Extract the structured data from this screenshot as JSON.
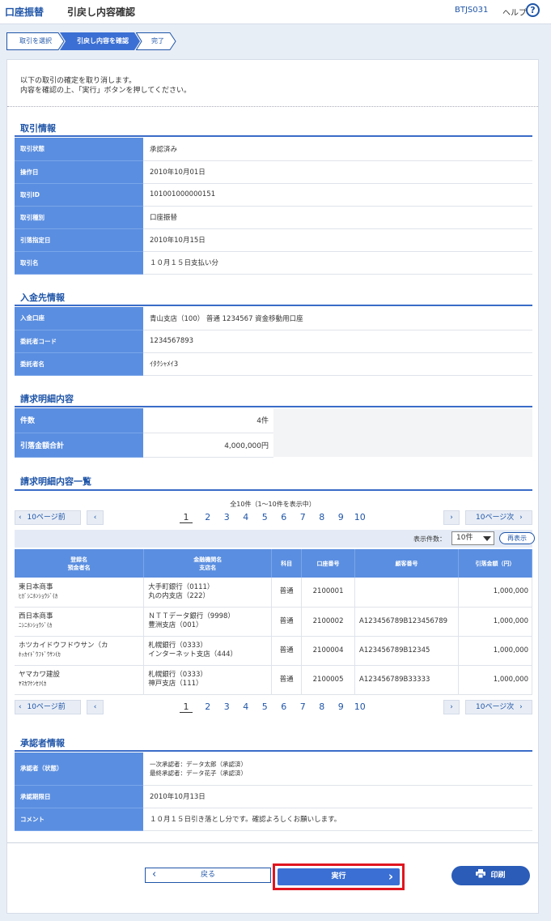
{
  "header": {
    "breadcrumb": "口座振替",
    "title": "引戻し内容確認",
    "screen_code": "BTJS031",
    "help_label": "ヘルプ",
    "help_icon": "?"
  },
  "steps": [
    "取引を選択",
    "引戻し内容を確認",
    "完了"
  ],
  "intro": [
    "以下の取引の確定を取り消します。",
    "内容を確認の上、「実行」ボタンを押してください。"
  ],
  "transaction_info": {
    "title": "取引情報",
    "rows": [
      {
        "label": "取引状態",
        "value": "承認済み"
      },
      {
        "label": "操作日",
        "value": "2010年10月01日"
      },
      {
        "label": "取引ID",
        "value": "101001000000151"
      },
      {
        "label": "取引種別",
        "value": "口座振替"
      },
      {
        "label": "引落指定日",
        "value": "2010年10月15日"
      },
      {
        "label": "取引名",
        "value": "１０月１５日支払い分"
      }
    ]
  },
  "deposit_info": {
    "title": "入金先情報",
    "rows": [
      {
        "label": "入金口座",
        "value": "青山支店（100） 普通 1234567 資金移動用口座"
      },
      {
        "label": "委託者コード",
        "value": "1234567893"
      },
      {
        "label": "委託者名",
        "value": "ｲﾀｸｼｬﾒｲ3"
      }
    ]
  },
  "billing_summary": {
    "title": "請求明細内容",
    "rows": [
      {
        "label": "件数",
        "value": "4件"
      },
      {
        "label": "引落金額合計",
        "value": "4,000,000円"
      }
    ]
  },
  "billing_list": {
    "title": "請求明細内容一覧",
    "count_text": "全10件（1～10件を表示中）",
    "prev10": "10ページ前",
    "next10": "10ページ次",
    "pages": [
      "1",
      "2",
      "3",
      "4",
      "5",
      "6",
      "7",
      "8",
      "9",
      "10"
    ],
    "display_count_label": "表示件数：",
    "display_count_value": "10件",
    "redisplay_label": "再表示",
    "headers": {
      "registrant": "登録名",
      "depositor": "預金者名",
      "bank": "金融機関名",
      "branch": "支店名",
      "subject": "科目",
      "account_no": "口座番号",
      "customer_no": "顧客番号",
      "amount": "引落金額（円）"
    },
    "rows": [
      {
        "registrant": "東日本商事",
        "depositor": "ﾋｶﾞｼﾆﾎﾝｼｮｳｼﾞ(ｶ",
        "bank": "大手町銀行（0111）",
        "branch": "丸の内支店（222）",
        "subject": "普通",
        "account_no": "2100001",
        "customer_no": "",
        "amount": "1,000,000"
      },
      {
        "registrant": "西日本商事",
        "depositor": "ﾆｼﾆﾎﾝｼｮｳｼﾞ(ｶ",
        "bank": "ＮＴＴデータ銀行（9998）",
        "branch": "豊洲支店（001）",
        "subject": "普通",
        "account_no": "2100002",
        "customer_no": "A123456789B123456789",
        "amount": "1,000,000"
      },
      {
        "registrant": "ホツカイドウフドウサン（カ",
        "depositor": "ﾎｯｶｲﾄﾞｳﾌﾄﾞｳｻﾝ(ｶ",
        "bank": "札幌銀行（0333）",
        "branch": "インターネット支店（444）",
        "subject": "普通",
        "account_no": "2100004",
        "customer_no": "A123456789B12345",
        "amount": "1,000,000"
      },
      {
        "registrant": "ヤマカワ建設",
        "depositor": "ﾔﾏｶﾜｹﾝｾﾂ(ｶ",
        "bank": "札幌銀行（0333）",
        "branch": "神戸支店（111）",
        "subject": "普通",
        "account_no": "2100005",
        "customer_no": "A123456789B33333",
        "amount": "1,000,000"
      }
    ]
  },
  "approver_info": {
    "title": "承認者情報",
    "approver_label": "承認者（状態）",
    "approver_line1": "一次承認者：データ太郎（承認済）",
    "approver_line2": "最終承認者：データ花子（承認済）",
    "deadline_label": "承認期限日",
    "deadline_value": "2010年10月13日",
    "comment_label": "コメント",
    "comment_value": "１０月１５日引き落とし分です。確認よろしくお願いします。"
  },
  "buttons": {
    "back": "戻る",
    "execute": "実行",
    "print": "印刷"
  },
  "colors": {
    "accent": "#1f55a8",
    "header_cell": "#5a8ee0",
    "execute_button": "#3b6fd3",
    "highlight_border": "#e0151f"
  }
}
